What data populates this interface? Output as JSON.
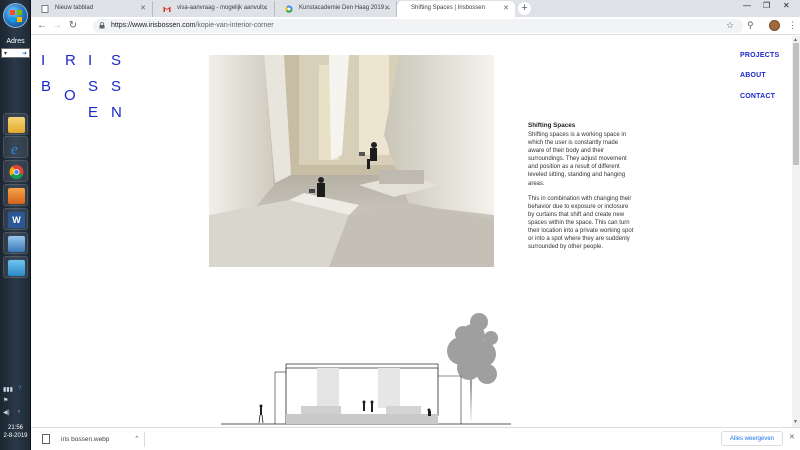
{
  "taskbar": {
    "address_label": "Adres",
    "clock_time": "21:56",
    "clock_date": "2-8-2019",
    "apps": [
      "folder-icon",
      "ie-icon",
      "chrome-icon",
      "media-player-icon",
      "word-icon",
      "explorer-window-icon",
      "feedback-icon"
    ]
  },
  "tabs": [
    {
      "label": "Nieuw tabblad",
      "icon": "page-icon"
    },
    {
      "label": "visa-aanvraag - mogelijk aanvull...",
      "icon": "gmail-icon"
    },
    {
      "label": "Kunstacademie Den Haag 2019 ...",
      "icon": "google-icon"
    },
    {
      "label": "Shifting Spaces | Irisbossen",
      "icon": "none"
    }
  ],
  "toolbar": {
    "url_host": "https://www.irisbossen.com",
    "url_path": "/kopie-van-interior-corner"
  },
  "site": {
    "logo_letters": [
      "I",
      "R",
      "I",
      "S",
      "B",
      "O",
      "S",
      "S",
      "E",
      "N"
    ],
    "nav": [
      "PROJECTS",
      "ABOUT",
      "CONTACT"
    ],
    "article_title": "Shifting Spaces",
    "paragraph1": "Shifting spaces is a working space in which the user is constantly made aware of their body and their surroundings. They adjust movement and position as a result of different leveled sitting, standing and hanging areas.",
    "paragraph2": "This in combination with changing their behavior due to exposure or inclosure by curtains that shift and create new spaces within the space. This can turn their location into a private working spot or into a spot where they are suddenly surrounded by other people."
  },
  "downloads": {
    "file_name": "iris bossen.webp",
    "show_all": "Alles weergeven"
  },
  "colors": {
    "brand_blue": "#1b28c9",
    "chrome_tabstrip": "#dee1e6",
    "taskbar": "#2a3848"
  }
}
